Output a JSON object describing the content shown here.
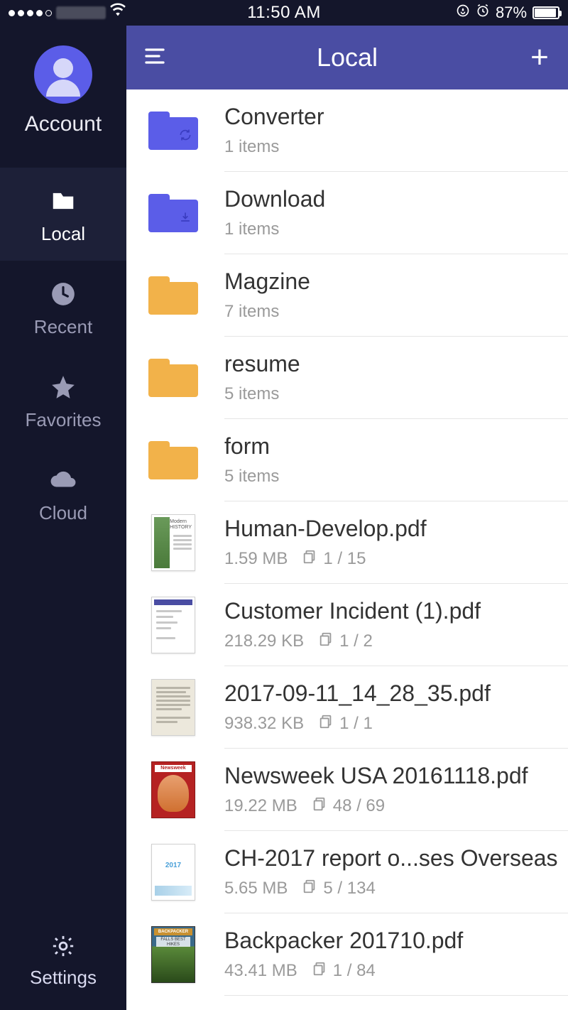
{
  "status": {
    "time": "11:50 AM",
    "battery_pct": "87%"
  },
  "sidebar": {
    "account_label": "Account",
    "items": [
      {
        "label": "Local"
      },
      {
        "label": "Recent"
      },
      {
        "label": "Favorites"
      },
      {
        "label": "Cloud"
      }
    ],
    "settings_label": "Settings"
  },
  "header": {
    "title": "Local"
  },
  "folders": [
    {
      "name": "Converter",
      "sub": "1 items",
      "color": "blue",
      "glyph": "sync"
    },
    {
      "name": "Download",
      "sub": "1 items",
      "color": "blue",
      "glyph": "download"
    },
    {
      "name": "Magzine",
      "sub": "7 items",
      "color": "orange",
      "glyph": ""
    },
    {
      "name": "resume",
      "sub": "5 items",
      "color": "orange",
      "glyph": ""
    },
    {
      "name": "form",
      "sub": "5 items",
      "color": "orange",
      "glyph": ""
    }
  ],
  "files": [
    {
      "name": "Human-Develop.pdf",
      "size": "1.59 MB",
      "pages": "1 / 15",
      "thumb": "doc-book"
    },
    {
      "name": "Customer Incident (1).pdf",
      "size": "218.29 KB",
      "pages": "1 / 2",
      "thumb": "doc-form"
    },
    {
      "name": "2017-09-11_14_28_35.pdf",
      "size": "938.32 KB",
      "pages": "1 / 1",
      "thumb": "doc-scan"
    },
    {
      "name": "Newsweek USA 20161118.pdf",
      "size": "19.22 MB",
      "pages": "48 / 69",
      "thumb": "mag-red"
    },
    {
      "name": "CH-2017 report o...ses Overseas",
      "size": "5.65 MB",
      "pages": "5 / 134",
      "thumb": "doc-report"
    },
    {
      "name": "Backpacker 201710.pdf",
      "size": "43.41 MB",
      "pages": "1 / 84",
      "thumb": "mag-green"
    }
  ]
}
